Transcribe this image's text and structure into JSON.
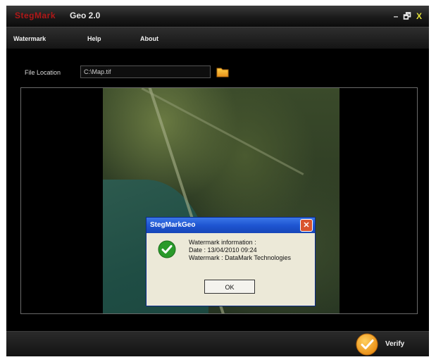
{
  "titlebar": {
    "logo": "StegMark",
    "title": "Geo 2.0",
    "minimize": "–",
    "maximize": "🗗",
    "close": "X"
  },
  "menu": {
    "items": [
      {
        "label": "Watermark"
      },
      {
        "label": "Help"
      },
      {
        "label": "About"
      }
    ]
  },
  "file": {
    "label": "File Location",
    "value": "C:\\Map.tif"
  },
  "dialog": {
    "title": "StegMarkGeo",
    "lines": [
      "Watermark information :",
      "Date : 13/04/2010  09:24",
      "Watermark : DataMark Technologies"
    ],
    "ok_label": "OK"
  },
  "footer": {
    "verify_label": "Verify"
  },
  "colors": {
    "accent": "#f0a020",
    "dialog_title": "#1e55d2",
    "success_icon": "#2a9a2a"
  }
}
